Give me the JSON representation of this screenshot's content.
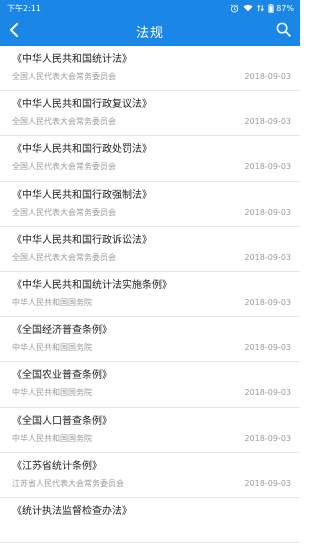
{
  "status_bar": {
    "time": "下午2:11",
    "battery": "87%"
  },
  "nav": {
    "title": "法规",
    "back_icon": "chevron-left-icon",
    "search_icon": "search-icon"
  },
  "colors": {
    "primary": "#1a86e6",
    "divider": "#e6e6e6",
    "meta_text": "#9a9a9a"
  },
  "laws": [
    {
      "title": "《中华人民共和国统计法》",
      "issuer": "全国人民代表大会常务委员会",
      "date": "2018-09-03"
    },
    {
      "title": "《中华人民共和国行政复议法》",
      "issuer": "全国人民代表大会常务委员会",
      "date": "2018-09-03"
    },
    {
      "title": "《中华人民共和国行政处罚法》",
      "issuer": "全国人民代表大会常务委员会",
      "date": "2018-09-03"
    },
    {
      "title": "《中华人民共和国行政强制法》",
      "issuer": "全国人民代表大会常务委员会",
      "date": "2018-09-03"
    },
    {
      "title": "《中华人民共和国行政诉讼法》",
      "issuer": "全国人民代表大会常务委员会",
      "date": "2018-09-03"
    },
    {
      "title": "《中华人民共和国统计法实施条例》",
      "issuer": "中华人民共和国国务院",
      "date": "2018-09-03"
    },
    {
      "title": "《全国经济普查条例》",
      "issuer": "中华人民共和国国务院",
      "date": "2018-09-03"
    },
    {
      "title": "《全国农业普查条例》",
      "issuer": "中华人民共和国国务院",
      "date": "2018-09-03"
    },
    {
      "title": "《全国人口普查条例》",
      "issuer": "中华人民共和国国务院",
      "date": "2018-09-03"
    },
    {
      "title": "《江苏省统计条例》",
      "issuer": "江苏省人民代表大会常务委员会",
      "date": "2018-09-03"
    },
    {
      "title": "《统计执法监督检查办法》",
      "issuer": "",
      "date": ""
    }
  ]
}
